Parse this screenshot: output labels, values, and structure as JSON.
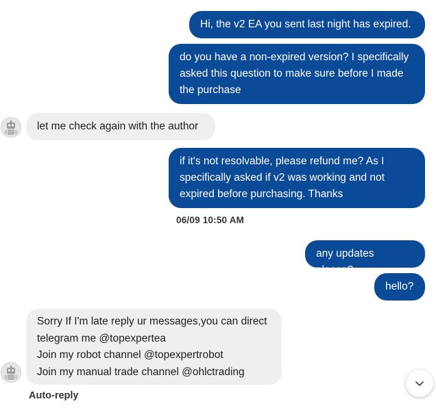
{
  "messages": [
    {
      "id": "m1",
      "direction": "outgoing",
      "text": "Hi, the v2 EA you sent last night has expired."
    },
    {
      "id": "m2",
      "direction": "outgoing",
      "text": "do you have a non-expired version? I specifically\nasked this question to make sure before I made\nthe purchase"
    },
    {
      "id": "m3",
      "direction": "incoming",
      "text": "let me check again with the author"
    },
    {
      "id": "m4",
      "direction": "outgoing",
      "text": "if it's not resolvable, please refund me? As I\nspecifically asked if v2 was working and not\nexpired before purchasing. Thanks"
    },
    {
      "id": "m5",
      "direction": "outgoing",
      "text": "any updates please?"
    },
    {
      "id": "m6",
      "direction": "outgoing",
      "text": "hello?"
    },
    {
      "id": "m7",
      "direction": "incoming",
      "text": "Sorry If I'm late reply ur messages,you can direct\ntelegram me @topexpertea\nJoin my robot channel @topexpertrobot\nJoin my manual trade channel @ohlctrading"
    }
  ],
  "timestamp": "06/09  10:50 AM",
  "auto_reply_label": "Auto-reply",
  "icons": {
    "avatar": "robot-avatar-icon",
    "scroll": "chevron-down-icon"
  },
  "colors": {
    "outgoing_bubble": "#0a4a96",
    "incoming_bubble": "#efefef"
  }
}
